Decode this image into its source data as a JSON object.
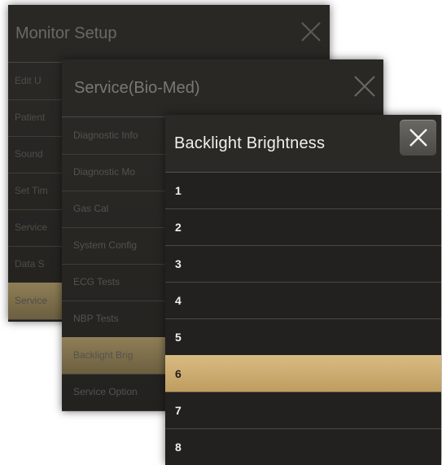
{
  "panels": [
    {
      "title": "Monitor Setup",
      "close_icon": "close-icon",
      "items": [
        {
          "label": "Edit U"
        },
        {
          "label": "Patient"
        },
        {
          "label": "Sound"
        },
        {
          "label": "Set Tim"
        },
        {
          "label": "Service"
        },
        {
          "label": "Data S"
        },
        {
          "label": "Service",
          "selected": true
        }
      ]
    },
    {
      "title": "Service(Bio-Med)",
      "close_icon": "close-icon",
      "items": [
        {
          "label": "Diagnostic Info"
        },
        {
          "label": "Diagnostic Mo"
        },
        {
          "label": "Gas Cal"
        },
        {
          "label": "System Config"
        },
        {
          "label": "ECG Tests"
        },
        {
          "label": "NBP Tests"
        },
        {
          "label": "Backlight Brig",
          "selected": true
        },
        {
          "label": "Service Option"
        }
      ]
    },
    {
      "title": "Backlight Brightness",
      "close_icon": "close-icon",
      "items": [
        {
          "label": "1"
        },
        {
          "label": "2"
        },
        {
          "label": "3"
        },
        {
          "label": "4"
        },
        {
          "label": "5"
        },
        {
          "label": "6",
          "selected": true
        },
        {
          "label": "7"
        },
        {
          "label": "8"
        }
      ]
    }
  ],
  "colors": {
    "panel_bg": "#2c2a27",
    "selected_gold": "#d1b170",
    "selected_dim": "#7e7050",
    "text_active": "#f1f0ec"
  }
}
